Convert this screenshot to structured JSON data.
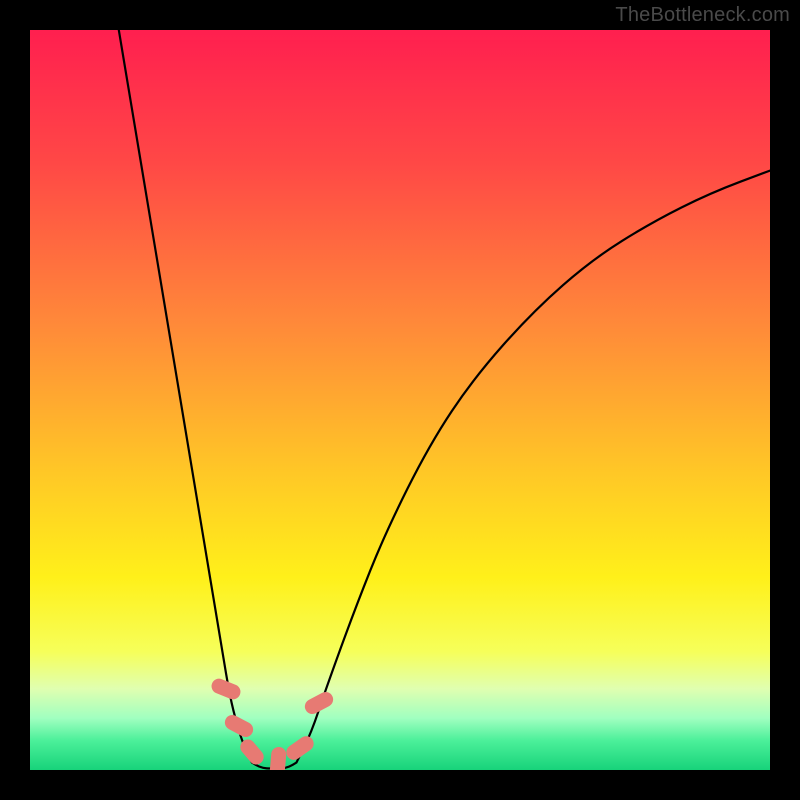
{
  "watermark": "TheBottleneck.com",
  "chart_data": {
    "type": "line",
    "title": "",
    "xlabel": "",
    "ylabel": "",
    "xlim": [
      0,
      100
    ],
    "ylim": [
      0,
      100
    ],
    "grid": false,
    "legend": false,
    "gradient_stops": [
      {
        "pct": 0,
        "color": "#ff1f4f"
      },
      {
        "pct": 18,
        "color": "#ff4846"
      },
      {
        "pct": 40,
        "color": "#ff8a39"
      },
      {
        "pct": 60,
        "color": "#ffc826"
      },
      {
        "pct": 74,
        "color": "#fff01a"
      },
      {
        "pct": 84,
        "color": "#f6ff5a"
      },
      {
        "pct": 89,
        "color": "#e0ffb0"
      },
      {
        "pct": 93,
        "color": "#a0ffc0"
      },
      {
        "pct": 96,
        "color": "#4cf09a"
      },
      {
        "pct": 100,
        "color": "#17d37a"
      }
    ],
    "series": [
      {
        "name": "left-branch",
        "x": [
          12,
          14,
          16,
          18,
          20,
          22,
          24,
          26,
          27,
          28,
          29,
          30
        ],
        "y": [
          100,
          88,
          76,
          64,
          52,
          40,
          28,
          16,
          10,
          6,
          3,
          1
        ]
      },
      {
        "name": "bottom-flat",
        "x": [
          30,
          31,
          32,
          33,
          34,
          35,
          36
        ],
        "y": [
          1,
          0.4,
          0.2,
          0.2,
          0.2,
          0.4,
          1
        ]
      },
      {
        "name": "right-branch",
        "x": [
          36,
          38,
          40,
          44,
          48,
          54,
          60,
          68,
          76,
          84,
          92,
          100
        ],
        "y": [
          1,
          5,
          11,
          22,
          32,
          44,
          53,
          62,
          69,
          74,
          78,
          81
        ]
      }
    ],
    "markers": [
      {
        "x": 26.5,
        "y": 11,
        "w": 15,
        "h": 30,
        "angle": -68
      },
      {
        "x": 28.3,
        "y": 6,
        "w": 15,
        "h": 30,
        "angle": -62
      },
      {
        "x": 30.0,
        "y": 2.5,
        "w": 15,
        "h": 28,
        "angle": -40
      },
      {
        "x": 33.5,
        "y": 1,
        "w": 15,
        "h": 32,
        "angle": 5
      },
      {
        "x": 36.5,
        "y": 3,
        "w": 15,
        "h": 30,
        "angle": 55
      },
      {
        "x": 39.0,
        "y": 9,
        "w": 15,
        "h": 30,
        "angle": 62
      }
    ]
  }
}
